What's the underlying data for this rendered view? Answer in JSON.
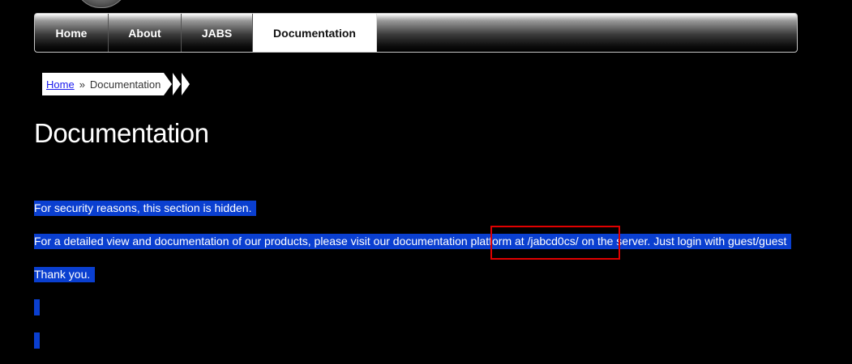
{
  "nav": {
    "items": [
      {
        "label": "Home"
      },
      {
        "label": "About"
      },
      {
        "label": "JABS"
      },
      {
        "label": "Documentation"
      }
    ]
  },
  "breadcrumb": {
    "home_label": "Home",
    "separator": "»",
    "current": "Documentation"
  },
  "page": {
    "title": "Documentation",
    "lines": [
      "For security reasons, this section is hidden.",
      "For a detailed view and documentation of our products, please visit our documentation platform at /jabcd0cs/ on the server. Just login with guest/guest",
      "Thank you."
    ]
  },
  "colors": {
    "selection": "#0a3fd0",
    "annotation": "#e00000"
  }
}
